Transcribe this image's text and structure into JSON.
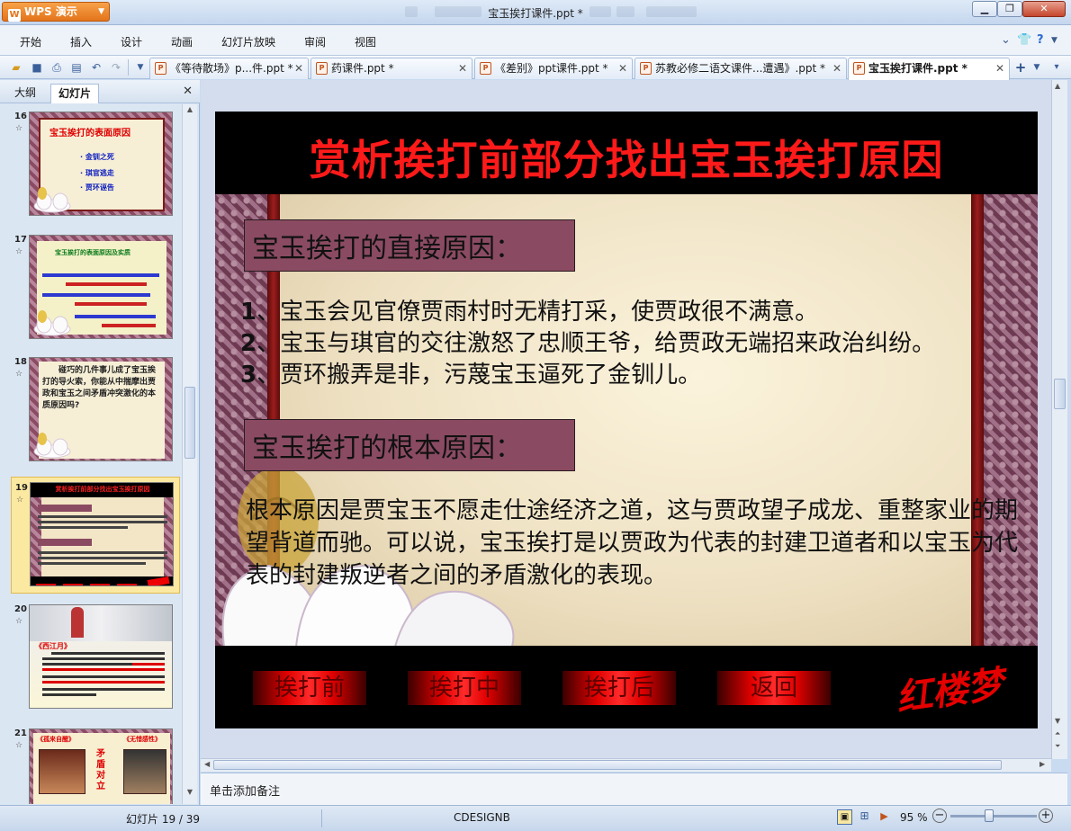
{
  "window": {
    "title": "宝玉挨打课件.ppt *",
    "app_button": "WPS 演示"
  },
  "menu": [
    "开始",
    "插入",
    "设计",
    "动画",
    "幻灯片放映",
    "审阅",
    "视图"
  ],
  "doc_tabs": [
    {
      "label": "《等待散场》p...件.ppt *"
    },
    {
      "label": "药课件.ppt *"
    },
    {
      "label": "《差别》ppt课件.ppt *"
    },
    {
      "label": "苏教必修二语文课件...遭遇》.ppt *"
    },
    {
      "label": "宝玉挨打课件.ppt *"
    }
  ],
  "left_pane": {
    "tab_outline": "大纲",
    "tab_slides": "幻灯片",
    "thumbs": [
      {
        "num": "16",
        "title": "宝玉挨打的表面原因",
        "lines": [
          "· 金钏之死",
          "· 琪官逃走",
          "· 贾环诬告"
        ]
      },
      {
        "num": "17",
        "title": "宝玉挨打的表面原因及实质"
      },
      {
        "num": "18",
        "text": "碰巧的几件事儿成了宝玉挨打的导火索，你能从中揣摩出贾政和宝玉之间矛盾冲突激化的本质原因吗?"
      },
      {
        "num": "19",
        "title": "赏析挨打前部分找出宝玉挨打原因"
      },
      {
        "num": "20",
        "title": "《西江月》"
      },
      {
        "num": "21",
        "left": "《孤来自醒》",
        "right": "《无惜感性》",
        "middle": "矛盾对立"
      }
    ]
  },
  "slide": {
    "title": "赏析挨打前部分找出宝玉挨打原因",
    "direct_heading": "宝玉挨打的直接原因：",
    "reasons": [
      {
        "n": "1",
        "text": "、宝玉会见官僚贾雨村时无精打采，使贾政很不满意。"
      },
      {
        "n": "2",
        "text": "、宝玉与琪官的交往激怒了忠顺王爷，给贾政无端招来政治纠纷。"
      },
      {
        "n": "3",
        "text": "、贾环搬弄是非，污蔑宝玉逼死了金钏儿。"
      }
    ],
    "root_heading": "宝玉挨打的根本原因：",
    "root_text": "根本原因是贾宝玉不愿走仕途经济之道，这与贾政望子成龙、重整家业的期望背道而驰。可以说，宝玉挨打是以贾政为代表的封建卫道者和以宝玉为代表的封建叛逆者之间的矛盾激化的表现。",
    "buttons": [
      "挨打前",
      "挨打中",
      "挨打后",
      "返回"
    ],
    "logo": "红楼梦"
  },
  "notes_placeholder": "单击添加备注",
  "status": {
    "slide_count": "幻灯片 19 / 39",
    "template": "CDESIGNB",
    "zoom": "95 %",
    "zoom_level": 0.95
  },
  "colors": {
    "title_red": "#ff1a1a",
    "accent_orange": "#e4741a",
    "selected_thumb": "#fbe9a2"
  }
}
